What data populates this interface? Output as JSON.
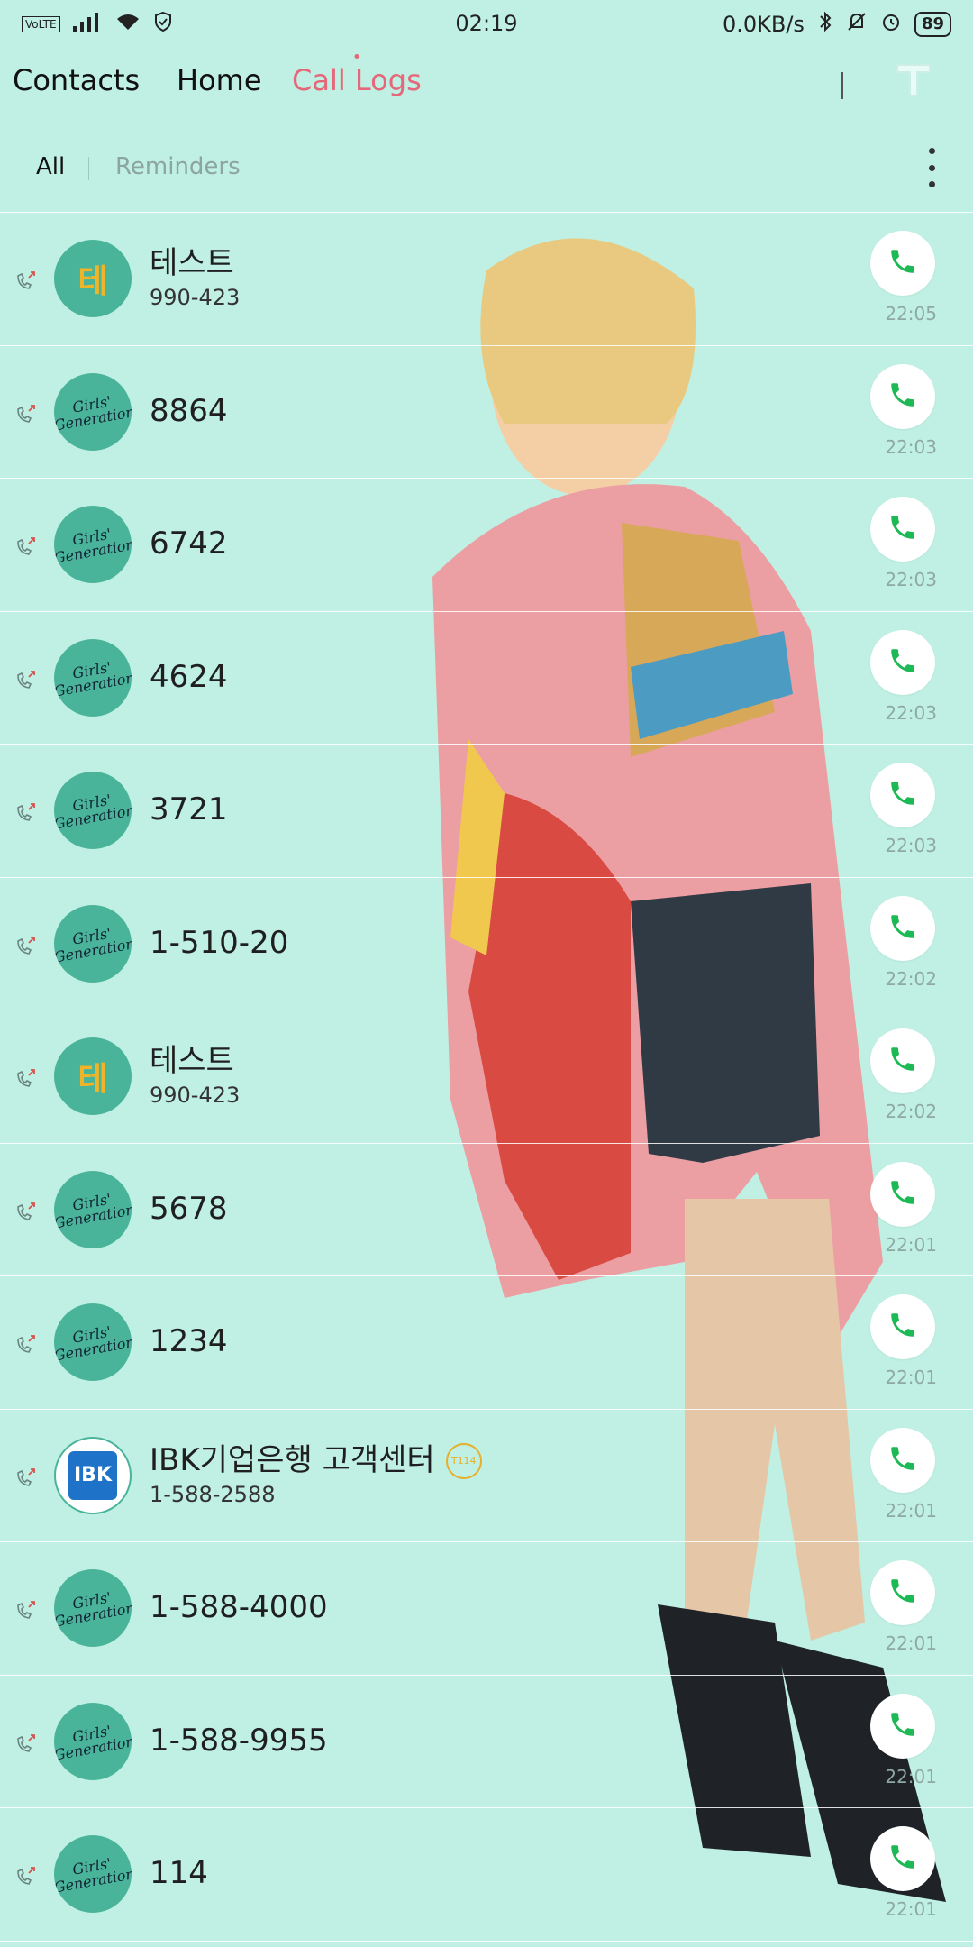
{
  "status_bar": {
    "network_badge": "VoLTE",
    "time": "02:19",
    "speed": "0.0KB/s",
    "battery": "89"
  },
  "nav": {
    "tabs": [
      "Contacts",
      "Home",
      "Call Logs"
    ],
    "active_tab": "Call Logs",
    "right_icon": "t-logo-icon"
  },
  "subtabs": {
    "all_label": "All",
    "reminders_label": "Reminders"
  },
  "colors": {
    "background": "#bff0e3",
    "accent": "#e5677a",
    "avatar": "#49b49a",
    "call_green": "#1db954"
  },
  "call_logs": [
    {
      "avatar": "initial",
      "avatar_text": "테",
      "name": "테스트",
      "number": "990-423",
      "time": "22:05"
    },
    {
      "avatar": "logo",
      "avatar_text": "Girls' Generation",
      "name": "8864",
      "number": "",
      "time": "22:03"
    },
    {
      "avatar": "logo",
      "avatar_text": "Girls' Generation",
      "name": "6742",
      "number": "",
      "time": "22:03"
    },
    {
      "avatar": "logo",
      "avatar_text": "Girls' Generation",
      "name": "4624",
      "number": "",
      "time": "22:03"
    },
    {
      "avatar": "logo",
      "avatar_text": "Girls' Generation",
      "name": "3721",
      "number": "",
      "time": "22:03"
    },
    {
      "avatar": "logo",
      "avatar_text": "Girls' Generation",
      "name": "1-510-20",
      "number": "",
      "time": "22:02"
    },
    {
      "avatar": "initial",
      "avatar_text": "테",
      "name": "테스트",
      "number": "990-423",
      "time": "22:02"
    },
    {
      "avatar": "logo",
      "avatar_text": "Girls' Generation",
      "name": "5678",
      "number": "",
      "time": "22:01"
    },
    {
      "avatar": "logo",
      "avatar_text": "Girls' Generation",
      "name": "1234",
      "number": "",
      "time": "22:01"
    },
    {
      "avatar": "ibk",
      "avatar_text": "IBK",
      "name": "IBK기업은행 고객센터",
      "badge": "T114",
      "number": "1-588-2588",
      "time": "22:01"
    },
    {
      "avatar": "logo",
      "avatar_text": "Girls' Generation",
      "name": "1-588-4000",
      "number": "",
      "time": "22:01"
    },
    {
      "avatar": "logo",
      "avatar_text": "Girls' Generation",
      "name": "1-588-9955",
      "number": "",
      "time": "22:01"
    },
    {
      "avatar": "logo",
      "avatar_text": "Girls' Generation",
      "name": "114",
      "number": "",
      "time": "22:01"
    }
  ]
}
